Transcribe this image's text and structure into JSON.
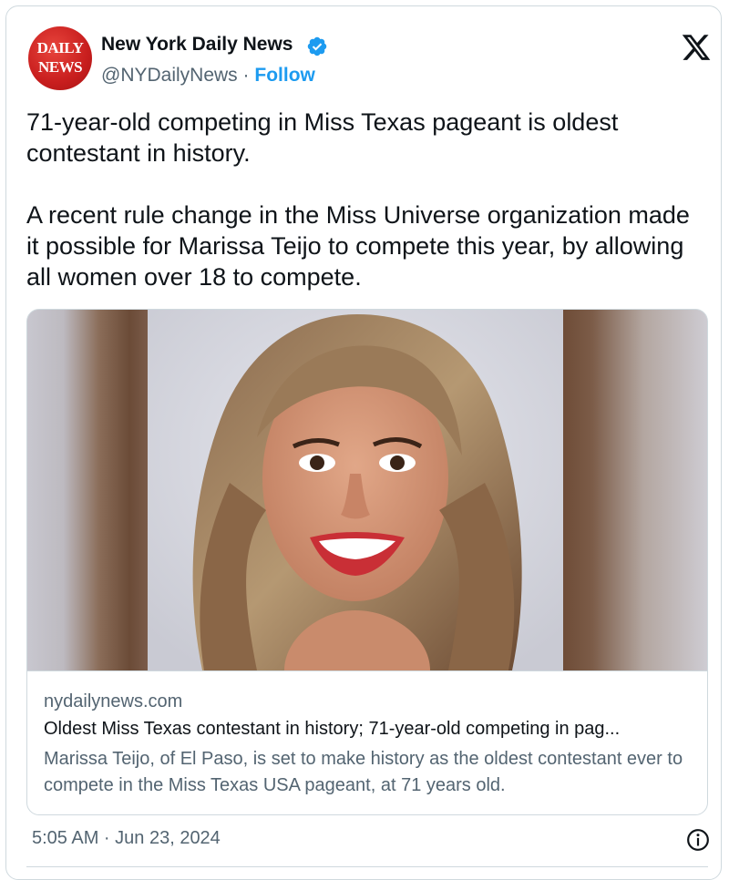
{
  "author": {
    "avatar_text_line1": "DAILY",
    "avatar_text_line2": "NEWS",
    "name": "New York Daily News",
    "handle": "@NYDailyNews",
    "separator": "·",
    "follow_label": "Follow"
  },
  "tweet": {
    "paragraph1": "71-year-old competing in Miss Texas pageant is oldest contestant in history.",
    "paragraph2": "A recent rule change in the Miss Universe organization made it possible for Marissa Teijo to compete this year, by allowing all women over 18 to compete."
  },
  "card": {
    "domain": "nydailynews.com",
    "title": "Oldest Miss Texas contestant in history; 71-year-old competing in pag...",
    "description": "Marissa Teijo, of El Paso, is set to make history as the oldest contestant ever to compete in the Miss Texas USA pageant, at 71 years old."
  },
  "meta": {
    "timestamp": "5:05 AM · Jun 23, 2024"
  },
  "icons": {
    "verified": "verified-badge-icon",
    "platform": "x-logo-icon",
    "info": "info-icon"
  },
  "colors": {
    "link": "#1d9bf0",
    "muted_text": "#536471",
    "border": "#cfd9de",
    "avatar_red": "#c81e1e"
  }
}
